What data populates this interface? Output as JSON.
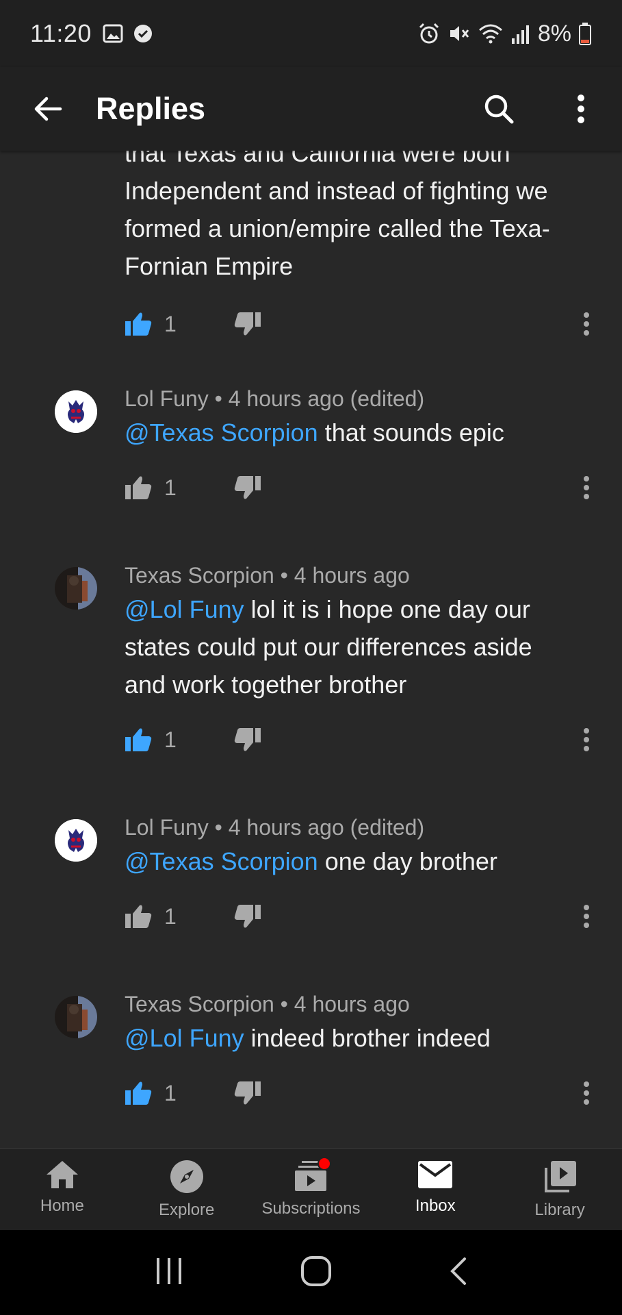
{
  "status": {
    "time": "11:20",
    "battery": "8%"
  },
  "header": {
    "title": "Replies"
  },
  "top_comment": {
    "text_cut": "that Texas and California were both",
    "text": "Independent and instead of fighting we formed a union/empire called the Texa-Fornian Empire",
    "likes": "1",
    "liked": true
  },
  "comments": [
    {
      "meta": "Lol Funy • 4 hours ago (edited)",
      "mention": "@Texas Scorpion",
      "text": " that sounds epic",
      "likes": "1",
      "liked": false
    },
    {
      "meta": "Texas Scorpion • 4 hours ago",
      "mention": "@Lol Funy",
      "text": " lol it is i hope one day our states could put our differences aside and work together brother",
      "likes": "1",
      "liked": true
    },
    {
      "meta": "Lol Funy • 4 hours ago (edited)",
      "mention": "@Texas Scorpion",
      "text": " one day brother",
      "likes": "1",
      "liked": false
    },
    {
      "meta": "Texas Scorpion • 4 hours ago",
      "mention": "@Lol Funy",
      "text": " indeed brother indeed",
      "likes": "1",
      "liked": true
    }
  ],
  "nav": {
    "items": [
      {
        "label": "Home",
        "icon": "home-icon"
      },
      {
        "label": "Explore",
        "icon": "compass-icon"
      },
      {
        "label": "Subscriptions",
        "icon": "subscriptions-icon"
      },
      {
        "label": "Inbox",
        "icon": "inbox-icon"
      },
      {
        "label": "Library",
        "icon": "library-icon"
      }
    ],
    "active": "Inbox"
  },
  "colors": {
    "background": "#282828",
    "accent": "#3ea6ff",
    "notification": "#ff0000"
  }
}
